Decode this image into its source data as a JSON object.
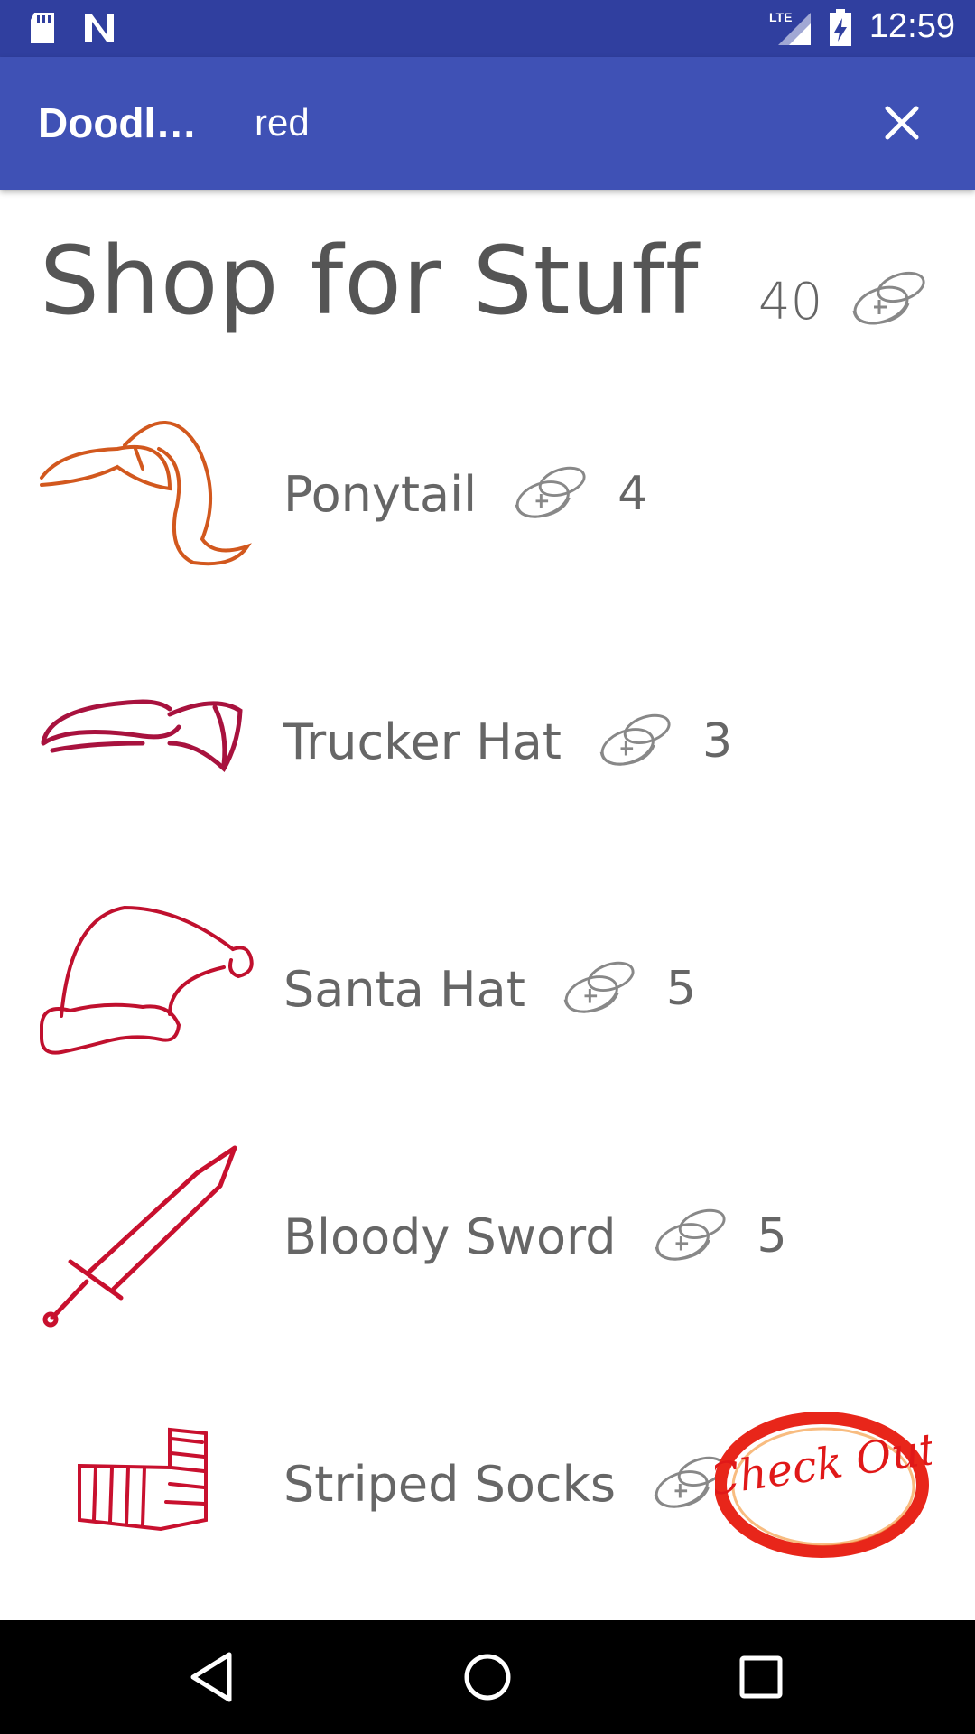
{
  "status_bar": {
    "time": "12:59",
    "icons": [
      "sd-card-icon",
      "n-icon",
      "lte-signal-icon",
      "battery-icon"
    ]
  },
  "app_bar": {
    "title": "Doodl…",
    "search_value": "red",
    "close_icon": "close-icon",
    "background": "#3f51b5",
    "status_color": "#303f9f"
  },
  "shop": {
    "title": "Shop for Stuff",
    "coin_balance": "40",
    "items": [
      {
        "name": "Ponytail",
        "price": "4",
        "icon": "ponytail-icon"
      },
      {
        "name": "Trucker Hat",
        "price": "3",
        "icon": "trucker-hat-icon"
      },
      {
        "name": "Santa Hat",
        "price": "5",
        "icon": "santa-hat-icon"
      },
      {
        "name": "Bloody Sword",
        "price": "5",
        "icon": "sword-icon"
      },
      {
        "name": "Striped Socks",
        "price": "",
        "icon": "socks-icon"
      }
    ],
    "checkout_label": "Check Out"
  },
  "nav_bar": {
    "icons": [
      "back-icon",
      "home-icon",
      "recents-icon"
    ]
  }
}
